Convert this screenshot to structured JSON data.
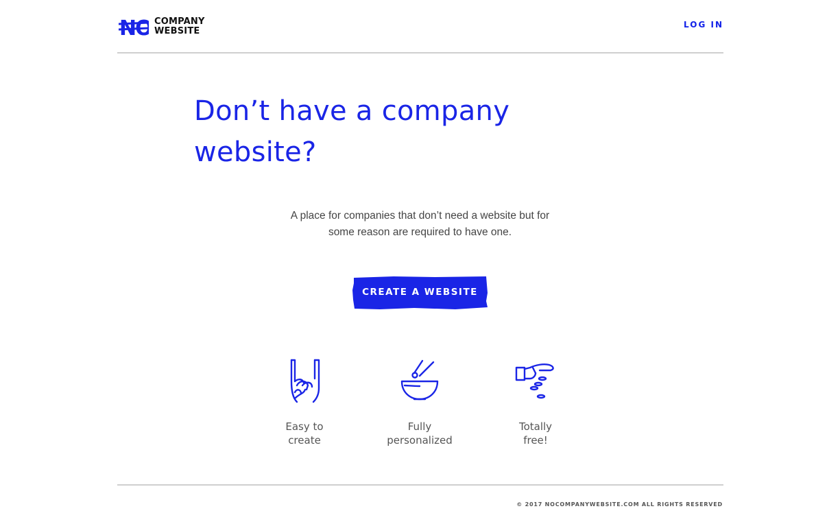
{
  "header": {
    "logo_mark": "NO",
    "logo_line1": "COMPANY",
    "logo_line2": "WEBSITE",
    "login_label": "LOG IN"
  },
  "hero": {
    "headline": "Don’t have a company website?",
    "subtext_line1": "A place for companies that don’t need a website but for",
    "subtext_line2": "some reason are required to have one.",
    "cta_label": "CREATE A WEBSITE"
  },
  "features": [
    {
      "icon": "rock-hand-icon",
      "line1": "Easy to",
      "line2": "create"
    },
    {
      "icon": "bowl-chopsticks-icon",
      "line1": "Fully",
      "line2": "personalized"
    },
    {
      "icon": "hand-dropping-coins-icon",
      "line1": "Totally",
      "line2": "free!"
    }
  ],
  "footer": {
    "copyright": "© 2017 NOCOMPANYWEBSITE.COM ALL RIGHTS RESERVED"
  },
  "colors": {
    "brand_blue": "#1a25e6",
    "divider": "#cfcfcf",
    "text_gray": "#444444"
  }
}
